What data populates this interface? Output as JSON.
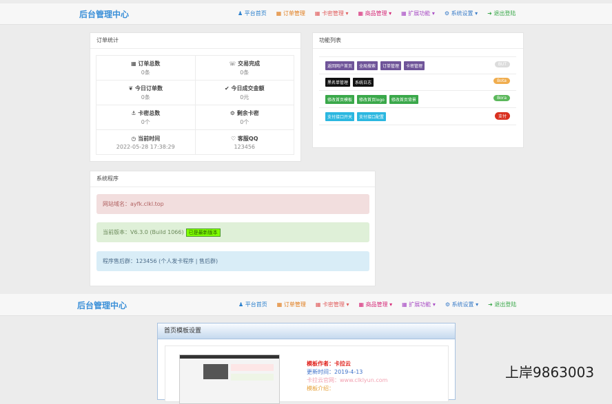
{
  "brand": "后台管理中心",
  "nav": {
    "home": "平台首页",
    "orders": "订单管理",
    "cards": "卡密管理",
    "goods": "商品管理",
    "extend": "扩展功能",
    "system": "系统设置",
    "logout": "退出登陆"
  },
  "order_stats": {
    "title": "订单统计",
    "cells": [
      {
        "label": "订单总数",
        "value": "0条",
        "icon": "grid-icon"
      },
      {
        "label": "交易完成",
        "value": "0条",
        "icon": "cart-icon"
      },
      {
        "label": "今日订单数",
        "value": "0条",
        "icon": "leaf-icon"
      },
      {
        "label": "今日成交金额",
        "value": "0元",
        "icon": "check-icon"
      },
      {
        "label": "卡密总数",
        "value": "0个",
        "icon": "anchor-icon"
      },
      {
        "label": "剩余卡密",
        "value": "0个",
        "icon": "gear-icon"
      },
      {
        "label": "当前时间",
        "value": "2022-05-28 17:38:29",
        "icon": "clock-icon"
      },
      {
        "label": "客服QQ",
        "value": "123456",
        "icon": "heart-icon"
      }
    ]
  },
  "functions": {
    "title": "功能列表",
    "rows": [
      {
        "buttons": [
          "返回网户首页",
          "全局搜索",
          "订单管理",
          "卡密管理"
        ],
        "badge": "BUT",
        "badge_color": "#dcdcdc",
        "btn_color": "#6f5499"
      },
      {
        "buttons": [
          "黑名单管理",
          "系统日志"
        ],
        "badge": "Bota",
        "badge_color": "#f0ad4e",
        "btn_color": "#111111"
      },
      {
        "buttons": [
          "修改首页模板",
          "修改首页logo",
          "修改首页背景"
        ],
        "badge": "Bora",
        "badge_color": "#5cb85c",
        "btn_color": "#3aa84a"
      },
      {
        "buttons": [
          "支付接口开关",
          "支付接口配置"
        ],
        "badge": "支付",
        "badge_color": "#d9301f",
        "btn_color": "#2bb7e0"
      }
    ]
  },
  "system": {
    "title": "系统程序",
    "domain": "网站域名：ayfk.clkl.top",
    "version": "当前版本：V6.3.0 (Build 1066)",
    "version_tag": "已是最新版本",
    "support": "程序售后群：123456 (个人发卡程序 | 售后群)"
  },
  "template": {
    "title": "首页模板设置",
    "author": "模板作者：卡拉云",
    "updated": "更新时间：2019-4-13",
    "site": "卡拉云官网：www.clklyun.com",
    "intro": "模板介绍："
  },
  "watermark": "上岸9863003"
}
